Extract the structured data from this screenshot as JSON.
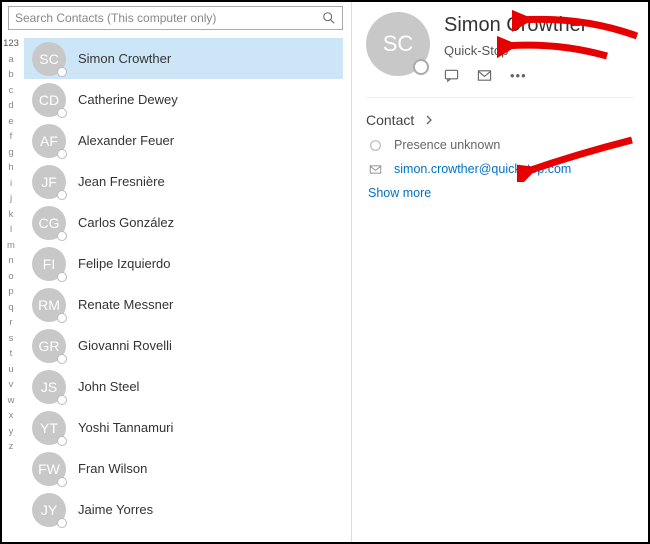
{
  "search": {
    "placeholder": "Search Contacts (This computer only)"
  },
  "alpha_index": [
    "123",
    "a",
    "b",
    "c",
    "d",
    "e",
    "f",
    "g",
    "h",
    "i",
    "j",
    "k",
    "l",
    "m",
    "n",
    "o",
    "p",
    "q",
    "r",
    "s",
    "t",
    "u",
    "v",
    "w",
    "x",
    "y",
    "z"
  ],
  "contacts": [
    {
      "initials": "SC",
      "name": "Simon Crowther",
      "selected": true
    },
    {
      "initials": "CD",
      "name": "Catherine Dewey",
      "selected": false
    },
    {
      "initials": "AF",
      "name": "Alexander Feuer",
      "selected": false
    },
    {
      "initials": "JF",
      "name": "Jean Fresnière",
      "selected": false
    },
    {
      "initials": "CG",
      "name": "Carlos González",
      "selected": false
    },
    {
      "initials": "FI",
      "name": "Felipe Izquierdo",
      "selected": false
    },
    {
      "initials": "RM",
      "name": "Renate Messner",
      "selected": false
    },
    {
      "initials": "GR",
      "name": "Giovanni Rovelli",
      "selected": false
    },
    {
      "initials": "JS",
      "name": "John Steel",
      "selected": false
    },
    {
      "initials": "YT",
      "name": "Yoshi Tannamuri",
      "selected": false
    },
    {
      "initials": "FW",
      "name": "Fran Wilson",
      "selected": false
    },
    {
      "initials": "JY",
      "name": "Jaime Yorres",
      "selected": false
    }
  ],
  "profile": {
    "initials": "SC",
    "name": "Simon Crowther",
    "company": "Quick-Stop",
    "section_label": "Contact",
    "presence_label": "Presence unknown",
    "email": "simon.crowther@quickstop.com",
    "show_more": "Show more"
  }
}
